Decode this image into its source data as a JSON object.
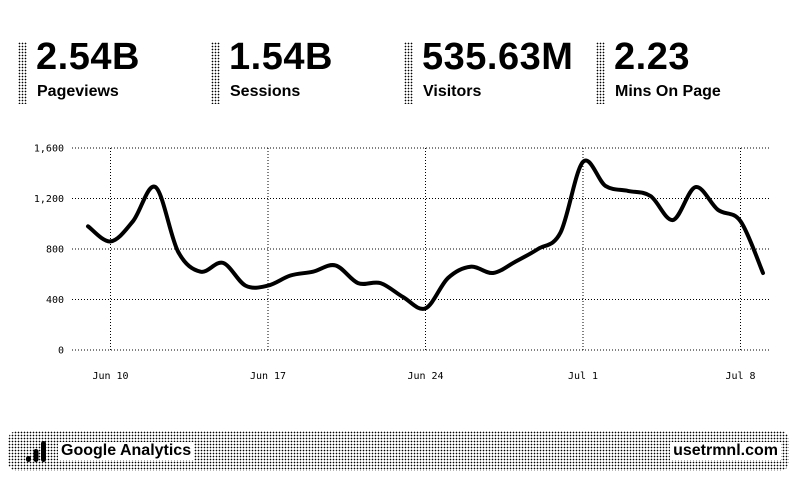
{
  "metrics": [
    {
      "value": "2.54B",
      "label": "Pageviews"
    },
    {
      "value": "1.54B",
      "label": "Sessions"
    },
    {
      "value": "535.63M",
      "label": "Visitors"
    },
    {
      "value": "2.23",
      "label": "Mins On Page"
    }
  ],
  "chart_data": {
    "type": "line",
    "x_start": "Jun 9",
    "x_labels": [
      "Jun 10",
      "Jun 17",
      "Jun 24",
      "Jul 1",
      "Jul 8"
    ],
    "y_ticks": [
      0,
      400,
      800,
      1200,
      1600
    ],
    "y_tick_labels": [
      "0",
      "400",
      "800",
      "1,200",
      "1,600"
    ],
    "ylim": [
      0,
      1600
    ],
    "grid": true,
    "line_color": "#000000",
    "series": [
      {
        "x": [
          "Jun 9",
          "Jun 10",
          "Jun 11",
          "Jun 12",
          "Jun 13",
          "Jun 14",
          "Jun 15",
          "Jun 16",
          "Jun 17",
          "Jun 18",
          "Jun 19",
          "Jun 20",
          "Jun 21",
          "Jun 22",
          "Jun 23",
          "Jun 24",
          "Jun 25",
          "Jun 26",
          "Jun 27",
          "Jun 28",
          "Jun 29",
          "Jun 30",
          "Jul 1",
          "Jul 2",
          "Jul 3",
          "Jul 4",
          "Jul 5",
          "Jul 6",
          "Jul 7",
          "Jul 8",
          "Jul 9"
        ],
        "values": [
          980,
          860,
          1020,
          1290,
          780,
          620,
          690,
          510,
          510,
          590,
          620,
          670,
          530,
          530,
          420,
          330,
          570,
          660,
          610,
          700,
          800,
          930,
          1490,
          1300,
          1260,
          1220,
          1030,
          1290,
          1110,
          1020,
          610
        ]
      }
    ]
  },
  "footer": {
    "brand": "Google Analytics",
    "site": "usetrmnl.com",
    "logo_icon": "bar-chart-icon"
  }
}
